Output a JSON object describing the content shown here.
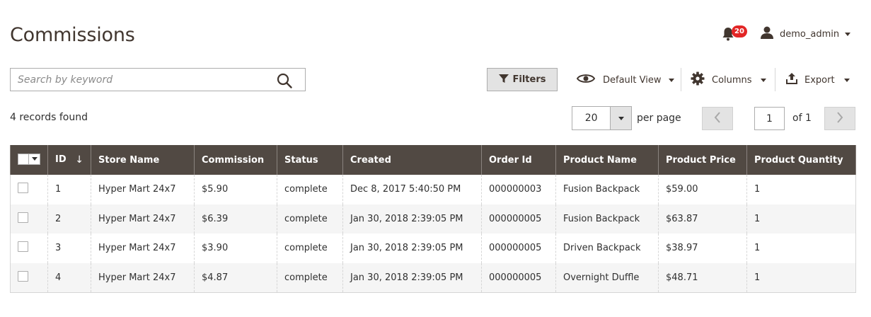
{
  "header": {
    "title": "Commissions",
    "notifications_count": "20",
    "user_name": "demo_admin"
  },
  "search": {
    "placeholder": "Search by keyword",
    "value": ""
  },
  "toolbar": {
    "filters_label": "Filters",
    "view_label": "Default View",
    "columns_label": "Columns",
    "export_label": "Export"
  },
  "records_found": "4 records found",
  "pagination": {
    "per_page_value": "20",
    "per_page_label": "per page",
    "current_page": "1",
    "of_label": "of 1"
  },
  "grid": {
    "columns": [
      "ID",
      "Store Name",
      "Commission",
      "Status",
      "Created",
      "Order Id",
      "Product Name",
      "Product Price",
      "Product Quantity"
    ],
    "sort_indicator": "↓",
    "rows": [
      [
        "1",
        "Hyper Mart 24x7",
        "$5.90",
        "complete",
        "Dec 8, 2017 5:40:50 PM",
        "000000003",
        "Fusion Backpack",
        "$59.00",
        "1"
      ],
      [
        "2",
        "Hyper Mart 24x7",
        "$6.39",
        "complete",
        "Jan 30, 2018 2:39:05 PM",
        "000000005",
        "Fusion Backpack",
        "$63.87",
        "1"
      ],
      [
        "3",
        "Hyper Mart 24x7",
        "$3.90",
        "complete",
        "Jan 30, 2018 2:39:05 PM",
        "000000005",
        "Driven Backpack",
        "$38.97",
        "1"
      ],
      [
        "4",
        "Hyper Mart 24x7",
        "$4.87",
        "complete",
        "Jan 30, 2018 2:39:05 PM",
        "000000005",
        "Overnight Duffle",
        "$48.71",
        "1"
      ]
    ]
  },
  "colors": {
    "header_bg": "#514943",
    "badge": "#e22626",
    "title_text": "#41362f",
    "row_alt": "#f5f5f5"
  }
}
